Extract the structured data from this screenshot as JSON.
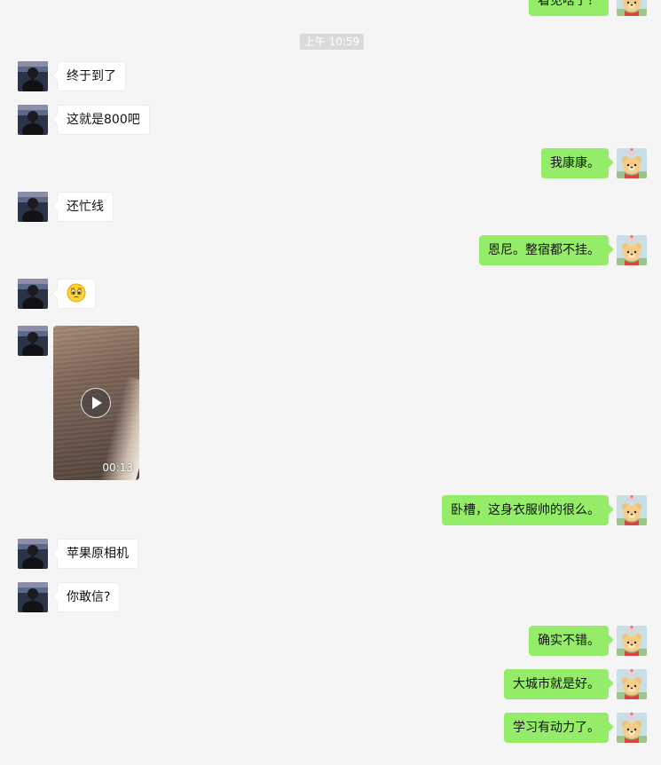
{
  "timestamp": "上午 10:59",
  "top_partial_message": "看见啥了？",
  "video": {
    "duration": "00:13"
  },
  "messages": [
    {
      "side": "left",
      "text": "终于到了"
    },
    {
      "side": "left",
      "text": "这就是800吧"
    },
    {
      "side": "right",
      "text": "我康康。"
    },
    {
      "side": "left",
      "text": "还忙线"
    },
    {
      "side": "right",
      "text": "恩尼。整宿都不挂。"
    },
    {
      "side": "left",
      "text": "",
      "emoji": "pleading-face-emoji"
    },
    {
      "side": "left",
      "type": "video"
    },
    {
      "side": "right",
      "text": "卧槽，这身衣服帅的很么。"
    },
    {
      "side": "left",
      "text": "苹果原相机"
    },
    {
      "side": "left",
      "text": "你敢信?"
    },
    {
      "side": "right",
      "text": "确实不错。"
    },
    {
      "side": "right",
      "text": "大城市就是好。"
    },
    {
      "side": "right",
      "text": "学习有动力了。"
    }
  ],
  "colors": {
    "background": "#f5f5f5",
    "right_bubble": "#95ec69",
    "left_bubble": "#ffffff",
    "timestamp_bg": "#dadada"
  },
  "icons": {
    "left_avatar": "person-avatar",
    "right_avatar": "bear-avatar",
    "video_play": "play-icon"
  }
}
